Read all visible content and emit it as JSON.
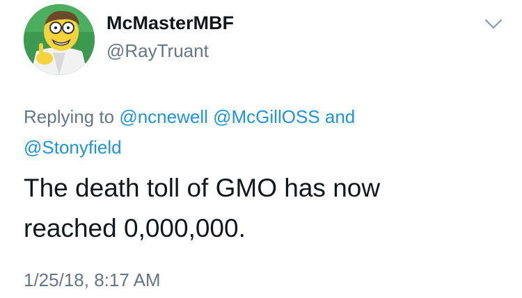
{
  "tweet": {
    "author": {
      "display_name": "McMasterMBF",
      "handle": "@RayTruant",
      "avatar_icon": "cartoon-scientist-avatar"
    },
    "more_icon": "chevron-down-icon",
    "replying": {
      "prefix": "Replying to",
      "mention_1": "@ncnewell",
      "mention_2": "@McGillOSS",
      "joiner": "and",
      "mention_3": "@Stonyfield"
    },
    "text_line_1": "The death toll of GMO has now",
    "text_line_2": "reached 0,000,000.",
    "timestamp": "1/25/18, 8:17 AM"
  },
  "colors": {
    "link": "#1b95e0",
    "secondary": "#657786",
    "primary_text": "#14171a",
    "background": "#ffffff"
  }
}
